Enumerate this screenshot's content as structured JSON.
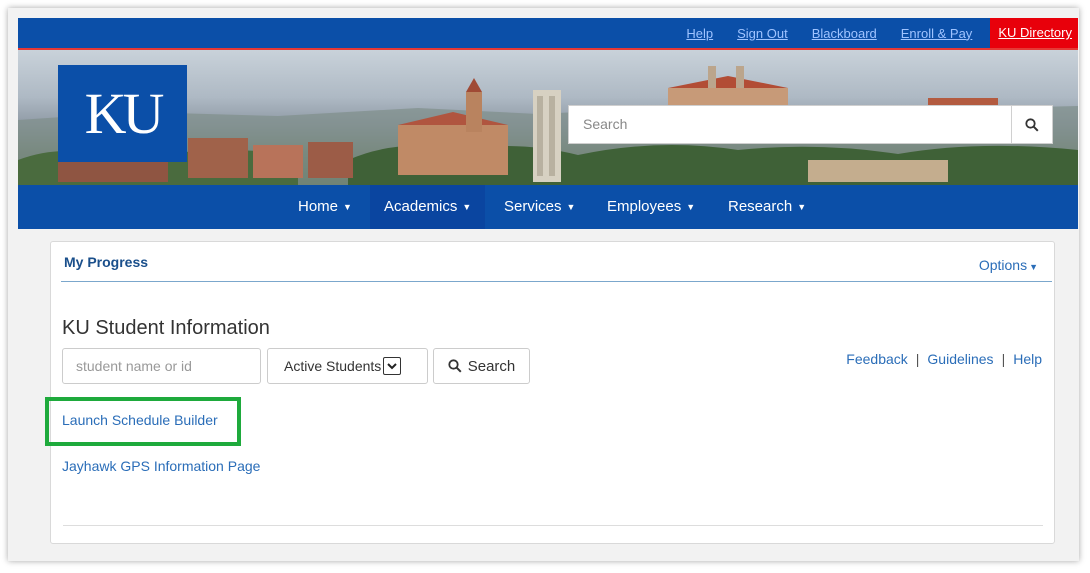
{
  "utility_links": [
    "Help",
    "Sign Out",
    "Blackboard",
    "Enroll & Pay",
    "KU Directory"
  ],
  "logo": "KU",
  "header_search": {
    "placeholder": "Search"
  },
  "nav": {
    "home": "Home",
    "academics": "Academics",
    "services": "Services",
    "employees": "Employees",
    "research": "Research"
  },
  "card": {
    "title": "My Progress",
    "options": "Options",
    "section_title": "KU Student Information",
    "student_input_placeholder": "student name or id",
    "student_filter": "Active Students",
    "search_button": "Search",
    "feedback": "Feedback",
    "guidelines": "Guidelines",
    "help": "Help",
    "separator": "|",
    "launch_link": "Launch Schedule Builder",
    "gps_link": "Jayhawk GPS Information Page"
  },
  "colors": {
    "ku_blue": "#0b4fa8",
    "ku_red": "#e8000b",
    "highlight_green": "#1eaa3c",
    "link_blue": "#2a6db8"
  }
}
